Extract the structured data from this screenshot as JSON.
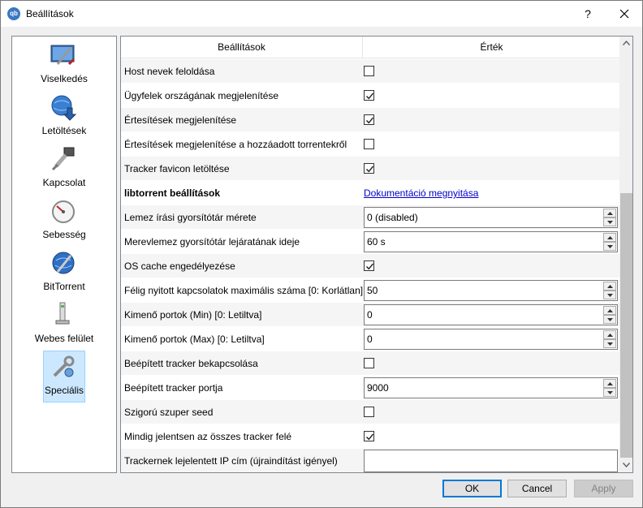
{
  "window": {
    "title": "Beállítások",
    "app_icon_text": "qb",
    "help_label": "?"
  },
  "sidebar": {
    "items": [
      {
        "label": "Viselkedés",
        "icon": "behavior-icon",
        "selected": false
      },
      {
        "label": "Letöltések",
        "icon": "downloads-icon",
        "selected": false
      },
      {
        "label": "Kapcsolat",
        "icon": "connection-icon",
        "selected": false
      },
      {
        "label": "Sebesség",
        "icon": "speed-icon",
        "selected": false
      },
      {
        "label": "BitTorrent",
        "icon": "bittorrent-icon",
        "selected": false
      },
      {
        "label": "Webes felület",
        "icon": "web-ui-icon",
        "selected": false
      },
      {
        "label": "Speciális",
        "icon": "advanced-icon",
        "selected": true
      }
    ]
  },
  "table": {
    "headers": {
      "setting": "Beállítások",
      "value": "Érték"
    },
    "rows": [
      {
        "name": "Host nevek feloldása",
        "type": "checkbox",
        "checked": false
      },
      {
        "name": "Ügyfelek országának megjelenítése",
        "type": "checkbox",
        "checked": true
      },
      {
        "name": "Értesítések megjelenítése",
        "type": "checkbox",
        "checked": true
      },
      {
        "name": "Értesítések megjelenítése a hozzáadott torrentekről",
        "type": "checkbox",
        "checked": false
      },
      {
        "name": "Tracker favicon letöltése",
        "type": "checkbox",
        "checked": true
      },
      {
        "name": "libtorrent beállítások",
        "type": "link",
        "bold": true,
        "value": "Dokumentáció megnyitása"
      },
      {
        "name": "Lemez írási gyorsítótár mérete",
        "type": "spin",
        "value": "0 (disabled)"
      },
      {
        "name": "Merevlemez gyorsítótár lejáratának ideje",
        "type": "spin",
        "value": "60 s"
      },
      {
        "name": "OS cache engedélyezése",
        "type": "checkbox",
        "checked": true
      },
      {
        "name": "Félig nyitott kapcsolatok maximális száma [0: Korlátlan]",
        "type": "spin",
        "value": "50"
      },
      {
        "name": "Kimenő portok (Min) [0: Letiltva]",
        "type": "spin",
        "value": "0"
      },
      {
        "name": "Kimenő portok (Max) [0: Letiltva]",
        "type": "spin",
        "value": "0"
      },
      {
        "name": "Beépített tracker bekapcsolása",
        "type": "checkbox",
        "checked": false
      },
      {
        "name": "Beépített tracker portja",
        "type": "spin",
        "value": "9000"
      },
      {
        "name": "Szigorú szuper seed",
        "type": "checkbox",
        "checked": false
      },
      {
        "name": "Mindig jelentsen az összes tracker felé",
        "type": "checkbox",
        "checked": true
      },
      {
        "name": "Trackernek lejelentett IP cím (újraindítást igényel)",
        "type": "text",
        "value": ""
      }
    ]
  },
  "buttons": {
    "ok": "OK",
    "cancel": "Cancel",
    "apply": "Apply"
  }
}
